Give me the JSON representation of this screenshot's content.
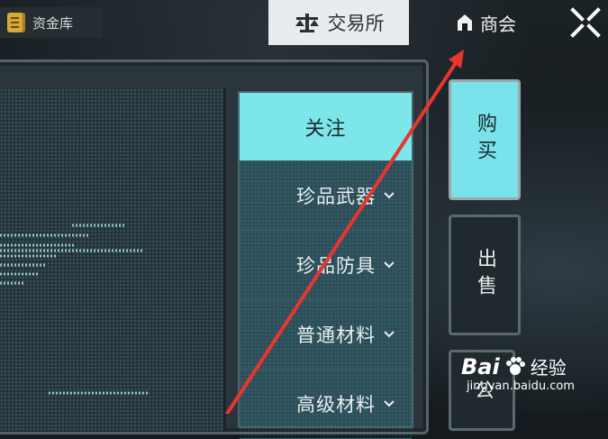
{
  "top_bar": {
    "vault_label": "资金库",
    "tabs": [
      {
        "label": "交易所",
        "icon": "scale-icon",
        "active": true
      },
      {
        "label": "商会",
        "icon": "house-icon",
        "active": false
      }
    ],
    "close_icon": "close-icon"
  },
  "categories": [
    {
      "label": "关注",
      "active": true
    },
    {
      "label": "珍品武器",
      "expandable": true
    },
    {
      "label": "珍品防具",
      "expandable": true
    },
    {
      "label": "普通材料",
      "expandable": true
    },
    {
      "label": "高级材料",
      "expandable": true
    }
  ],
  "side_tabs": [
    {
      "label": "购买",
      "active": true
    },
    {
      "label": "出售",
      "active": false
    },
    {
      "label": "公",
      "active": false
    }
  ],
  "watermark": {
    "brand": "Bai",
    "brand_cn": "经验",
    "url": "jingyan.baidu.com"
  },
  "colors": {
    "accent_cyan": "#7de6ea",
    "annotation_arrow": "#e8352f",
    "vault_gold": "#d7a93a"
  }
}
